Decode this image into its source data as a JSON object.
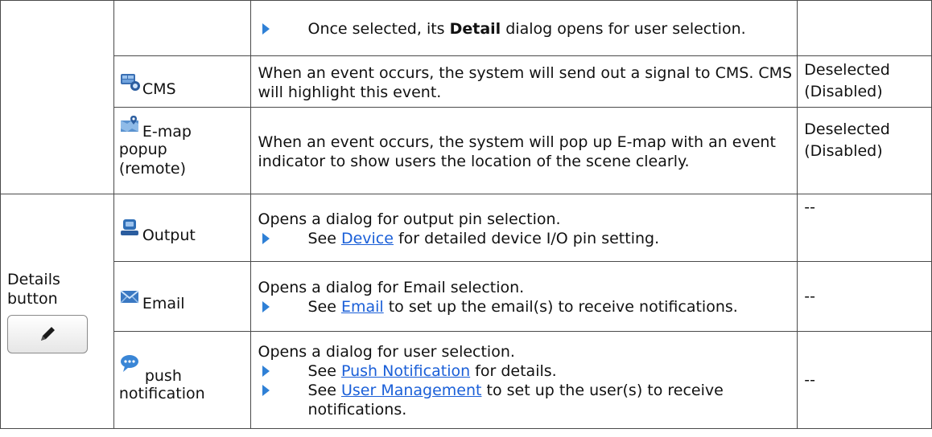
{
  "rows": {
    "detail_row": {
      "text_before": "Once selected, its ",
      "bold": "Detail",
      "text_after": " dialog opens for user selection."
    },
    "cms": {
      "icon": "cms-icon",
      "label": "CMS",
      "description": "When an event occurs, the system will send out a signal to CMS. CMS will highlight this event.",
      "default_line1": "Deselected",
      "default_line2": "(Disabled)"
    },
    "emap": {
      "icon": "emap-icon",
      "label_line1": "E-map",
      "label_line2": "popup",
      "label_line3": "(remote)",
      "description": "When an event occurs, the system will pop up E-map with an event indicator to show users the location of the scene clearly.",
      "default_line1": "Deselected",
      "default_line2": "(Disabled)"
    },
    "details_button": {
      "label": "Details button",
      "icon": "pencil-icon"
    },
    "output": {
      "icon": "output-icon",
      "label": "Output",
      "description": "Opens a dialog for output pin selection.",
      "bullet_before": "See ",
      "bullet_link": "Device",
      "bullet_after": " for detailed device I/O pin setting.",
      "default": "--"
    },
    "email": {
      "icon": "envelope-icon",
      "label": "Email",
      "description": "Opens a dialog for Email selection.",
      "bullet_before": "See ",
      "bullet_link": "Email",
      "bullet_after": " to set up the email(s) to receive notifications.",
      "default": "--"
    },
    "push": {
      "icon": "chat-bubble-icon",
      "label_line1": "push",
      "label_line2": "notification",
      "description": "Opens a dialog for user selection.",
      "bullet1_before": "See ",
      "bullet1_link": "Push Notification",
      "bullet1_after": " for details.",
      "bullet2_before": "See ",
      "bullet2_link": "User Management",
      "bullet2_after": " to set up the user(s) to receive notifications.",
      "default": "--"
    }
  },
  "colors": {
    "bullet_arrow": "#2f80d6",
    "link": "#1a5fd8",
    "border": "#4a4a4a"
  }
}
